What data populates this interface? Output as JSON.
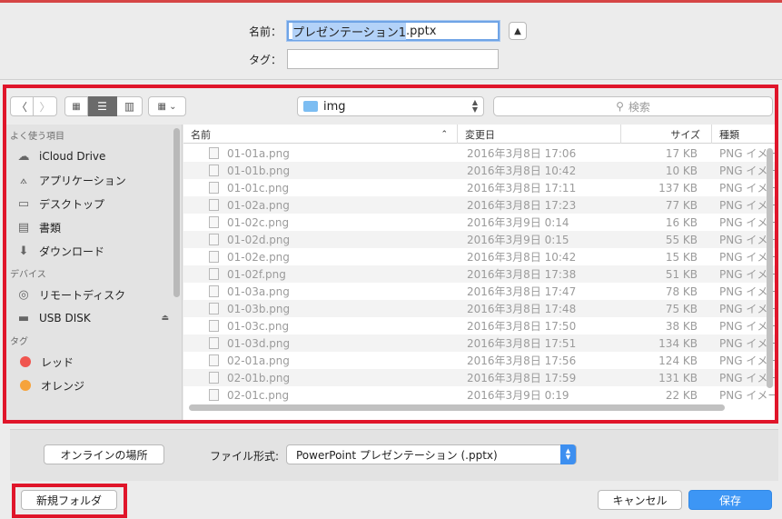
{
  "header": {
    "name_label": "名前：",
    "name_selected": "プレゼンテーション1",
    "name_ext": ".pptx",
    "tag_label": "タグ：",
    "tag_value": ""
  },
  "toolbar": {
    "folder": "img",
    "search_placeholder": "検索"
  },
  "sidebar": {
    "favorites_header": "よく使う項目",
    "favorites": [
      {
        "label": "iCloud Drive",
        "icon": "cloud-icon"
      },
      {
        "label": "アプリケーション",
        "icon": "applications-icon"
      },
      {
        "label": "デスクトップ",
        "icon": "desktop-icon"
      },
      {
        "label": "書類",
        "icon": "documents-icon"
      },
      {
        "label": "ダウンロード",
        "icon": "download-icon"
      }
    ],
    "devices_header": "デバイス",
    "devices": [
      {
        "label": "リモートディスク",
        "icon": "disc-icon"
      },
      {
        "label": "USB DISK",
        "icon": "drive-icon"
      }
    ],
    "tags_header": "タグ",
    "tags": [
      {
        "label": "レッド",
        "color": "#f0554f"
      },
      {
        "label": "オレンジ",
        "color": "#f6a33b"
      }
    ]
  },
  "list": {
    "columns": {
      "name": "名前",
      "date": "変更日",
      "size": "サイズ",
      "kind": "種類"
    },
    "rows": [
      {
        "name": "01-01a.png",
        "date": "2016年3月8日 17:06",
        "size": "17 KB",
        "kind": "PNG イメージ"
      },
      {
        "name": "01-01b.png",
        "date": "2016年3月8日 10:42",
        "size": "10 KB",
        "kind": "PNG イメージ"
      },
      {
        "name": "01-01c.png",
        "date": "2016年3月8日 17:11",
        "size": "137 KB",
        "kind": "PNG イメージ"
      },
      {
        "name": "01-02a.png",
        "date": "2016年3月8日 17:23",
        "size": "77 KB",
        "kind": "PNG イメージ"
      },
      {
        "name": "01-02c.png",
        "date": "2016年3月9日 0:14",
        "size": "16 KB",
        "kind": "PNG イメージ"
      },
      {
        "name": "01-02d.png",
        "date": "2016年3月9日 0:15",
        "size": "55 KB",
        "kind": "PNG イメージ"
      },
      {
        "name": "01-02e.png",
        "date": "2016年3月8日 10:42",
        "size": "15 KB",
        "kind": "PNG イメージ"
      },
      {
        "name": "01-02f.png",
        "date": "2016年3月8日 17:38",
        "size": "51 KB",
        "kind": "PNG イメージ"
      },
      {
        "name": "01-03a.png",
        "date": "2016年3月8日 17:47",
        "size": "78 KB",
        "kind": "PNG イメージ"
      },
      {
        "name": "01-03b.png",
        "date": "2016年3月8日 17:48",
        "size": "75 KB",
        "kind": "PNG イメージ"
      },
      {
        "name": "01-03c.png",
        "date": "2016年3月8日 17:50",
        "size": "38 KB",
        "kind": "PNG イメージ"
      },
      {
        "name": "01-03d.png",
        "date": "2016年3月8日 17:51",
        "size": "134 KB",
        "kind": "PNG イメージ"
      },
      {
        "name": "02-01a.png",
        "date": "2016年3月8日 17:56",
        "size": "124 KB",
        "kind": "PNG イメージ"
      },
      {
        "name": "02-01b.png",
        "date": "2016年3月8日 17:59",
        "size": "131 KB",
        "kind": "PNG イメージ"
      },
      {
        "name": "02-01c.png",
        "date": "2016年3月9日 0:19",
        "size": "22 KB",
        "kind": "PNG イメージ"
      }
    ]
  },
  "options": {
    "online_button": "オンラインの場所",
    "format_label": "ファイル形式:",
    "format_value": "PowerPoint プレゼンテーション (.pptx)"
  },
  "footer": {
    "new_folder": "新規フォルダ",
    "cancel": "キャンセル",
    "save": "保存"
  }
}
